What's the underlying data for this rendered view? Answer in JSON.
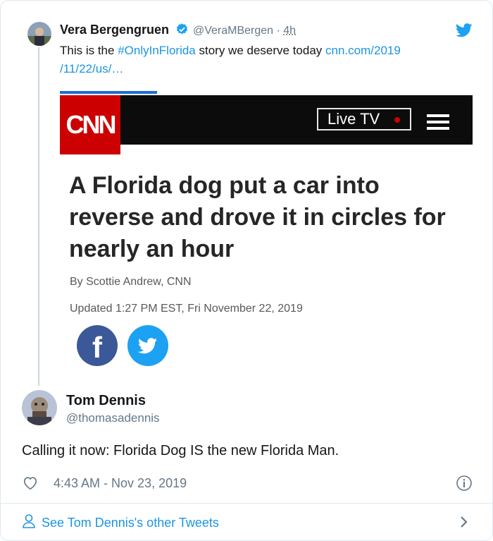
{
  "parent_tweet": {
    "author_name": "Vera Bergengruen",
    "author_handle": "@VeraMBergen",
    "separator": "·",
    "time_ago": "4h",
    "text_before": "This is the ",
    "hashtag": "#OnlyInFlorida",
    "text_after": " story we deserve today ",
    "link_line1": "cnn.com/2019",
    "link_line2": "/11/22/us/…",
    "card": {
      "logo_text": "CNN",
      "live_tv_label": "Live TV",
      "headline": "A Florida dog put a car into reverse and drove it in circles for nearly an hour",
      "byline": "By Scottie Andrew, CNN",
      "updated": "Updated 1:27 PM EST, Fri November 22, 2019",
      "facebook_glyph": "f"
    }
  },
  "reply_tweet": {
    "author_name": "Tom Dennis",
    "author_handle": "@thomasadennis",
    "text": "Calling it now: Florida Dog IS the new Florida Man.",
    "timestamp": "4:43 AM - Nov 23, 2019"
  },
  "footer": {
    "see_more_label": "See Tom Dennis's other Tweets"
  },
  "colors": {
    "link": "#1b95e0",
    "verified": "#1da1f2",
    "cnn_red": "#cc0000",
    "facebook": "#3b5998",
    "twitter": "#1da1f2"
  },
  "icons": [
    "verified-badge-icon",
    "twitter-bird-icon",
    "heart-icon",
    "info-icon",
    "person-icon",
    "chevron-right-icon",
    "hamburger-menu-icon",
    "facebook-icon",
    "twitter-share-icon"
  ]
}
